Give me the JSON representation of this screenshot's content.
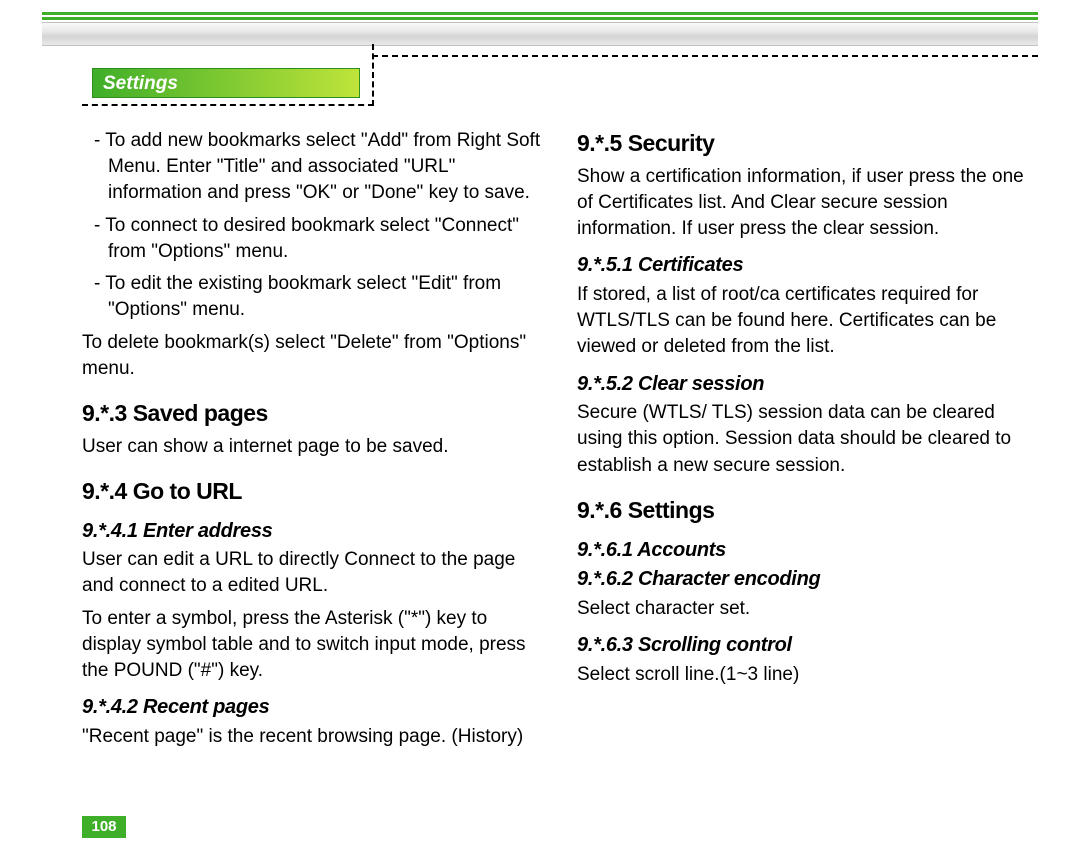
{
  "tab_label": "Settings",
  "page_number": "108",
  "left": {
    "bullet1": "- To add new bookmarks select \"Add\" from Right Soft Menu. Enter \"Title\" and associated \"URL\" information and press \"OK\" or \"Done\" key to save.",
    "bullet2": "- To connect to desired bookmark select \"Connect\" from \"Options\" menu.",
    "bullet3": "- To edit the existing bookmark select \"Edit\" from \"Options\" menu.",
    "para_delete": "To delete bookmark(s) select \"Delete\" from \"Options\" menu.",
    "h_saved": "9.*.3 Saved pages",
    "saved_body": "User can show  a internet page to be saved.",
    "h_goto": "9.*.4 Go to URL",
    "h_enter": "9.*.4.1 Enter address",
    "enter_p1": "User can edit a URL to directly Connect to the page and connect to a edited URL.",
    "enter_p2": "To enter a symbol, press the Asterisk (\"*\") key to display symbol table and to switch input mode, press the POUND (\"#\") key.",
    "h_recent": "9.*.4.2 Recent pages",
    "recent_body": "\"Recent page\" is the recent browsing page. (History)"
  },
  "right": {
    "h_security": "9.*.5 Security",
    "security_body": "Show a certification information, if user press the one of Certificates list. And Clear secure session information. If user press the clear session.",
    "h_cert": "9.*.5.1 Certificates",
    "cert_body": "If stored, a list of root/ca certificates required for WTLS/TLS can be found here. Certificates can be viewed or deleted from the list.",
    "h_clear": "9.*.5.2 Clear session",
    "clear_body": "Secure (WTLS/ TLS) session data can be cleared using this option. Session data should be cleared to establish a new secure session.",
    "h_settings": "9.*.6 Settings",
    "h_accounts": "9.*.6.1 Accounts",
    "h_charenc": "9.*.6.2 Character encoding",
    "charenc_body": "Select character set.",
    "h_scroll": "9.*.6.3 Scrolling control",
    "scroll_body": "Select scroll line.(1~3 line)"
  }
}
